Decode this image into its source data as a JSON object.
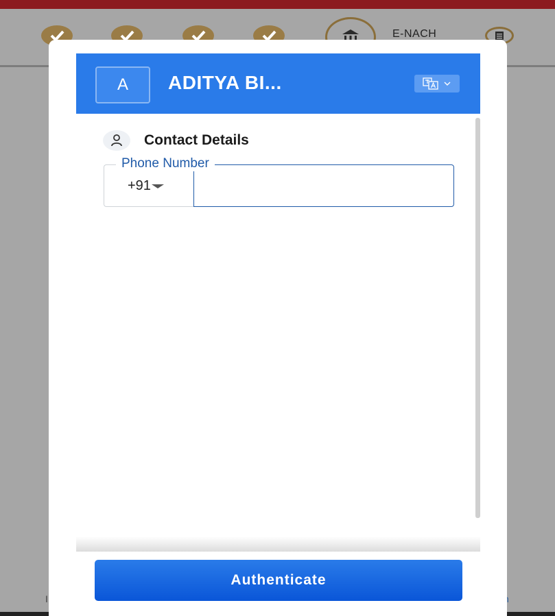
{
  "stepper": {
    "steps": [
      {
        "icon": "check-icon",
        "state": "done"
      },
      {
        "icon": "check-icon",
        "state": "done"
      },
      {
        "icon": "check-icon",
        "state": "done"
      },
      {
        "icon": "check-icon",
        "state": "done"
      },
      {
        "icon": "bank-icon",
        "state": "current",
        "label": "E-NACH"
      },
      {
        "icon": "document-icon",
        "state": "pending"
      }
    ]
  },
  "colors": {
    "topbar": "#8c1a1f",
    "step_done": "#9a7c46",
    "header": "#2a7be9",
    "field_accent": "#1f5aa8",
    "button": "#0a56d8"
  },
  "modal": {
    "avatar_letter": "A",
    "org_name": "ADITYA BI...",
    "language_icon": "translate-icon",
    "section": {
      "icon": "person-icon",
      "title": "Contact Details"
    },
    "phone": {
      "label": "Phone Number",
      "country_code": "+91",
      "value": "",
      "placeholder": ""
    },
    "authenticate_label": "Authenticate"
  }
}
